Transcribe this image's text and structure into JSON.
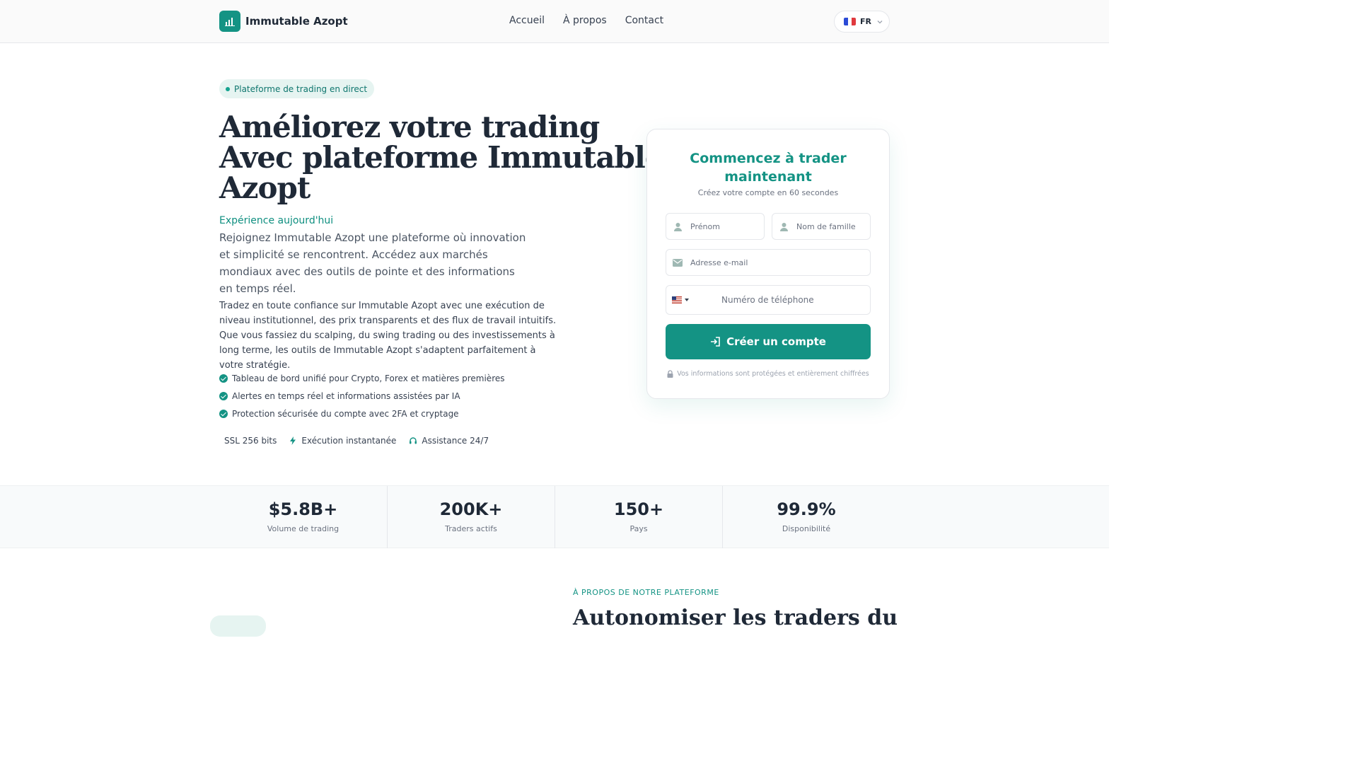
{
  "header": {
    "brand": "Immutable Azopt",
    "nav": [
      "Accueil",
      "À propos",
      "Contact"
    ],
    "lang": "FR"
  },
  "hero": {
    "badge": "Plateforme de trading en direct",
    "title_lines": [
      "Améliorez votre trading",
      "Avec plateforme Immutable",
      "Azopt"
    ],
    "kicker": "Expérience aujourd'hui",
    "lead": "Rejoignez Immutable Azopt une plateforme où innovation et simplicité se rencontrent. Accédez aux marchés mondiaux avec des outils de pointe et des informations en temps réel.",
    "body": "Tradez en toute confiance sur Immutable Azopt avec une exécution de niveau institutionnel, des prix transparents et des flux de travail intuitifs. Que vous fassiez du scalping, du swing trading ou des investissements à long terme, les outils de Immutable Azopt s'adaptent parfaitement à votre stratégie.",
    "features": [
      "Tableau de bord unifié pour Crypto, Forex et matières premières",
      "Alertes en temps réel et informations assistées par IA",
      "Protection sécurisée du compte avec 2FA et cryptage"
    ],
    "trust": [
      "SSL 256 bits",
      "Exécution instantanée",
      "Assistance 24/7"
    ]
  },
  "form": {
    "title": "Commencez à trader maintenant",
    "subtitle": "Créez votre compte en 60 secondes",
    "first_name_placeholder": "Prénom",
    "last_name_placeholder": "Nom de famille",
    "email_placeholder": "Adresse e-mail",
    "phone_placeholder": "Numéro de téléphone",
    "submit": "Créer un compte",
    "secure_note": "Vos informations sont protégées et entièrement chiffrées"
  },
  "stats": [
    {
      "value": "$5.8B+",
      "label": "Volume de trading"
    },
    {
      "value": "200K+",
      "label": "Traders actifs"
    },
    {
      "value": "150+",
      "label": "Pays"
    },
    {
      "value": "99.9%",
      "label": "Disponibilité"
    }
  ],
  "about": {
    "kicker": "À PROPOS DE NOTRE PLATEFORME",
    "title": "Autonomiser les traders du"
  },
  "colors": {
    "accent": "#149384",
    "accent_light": "#e6f4f1"
  }
}
